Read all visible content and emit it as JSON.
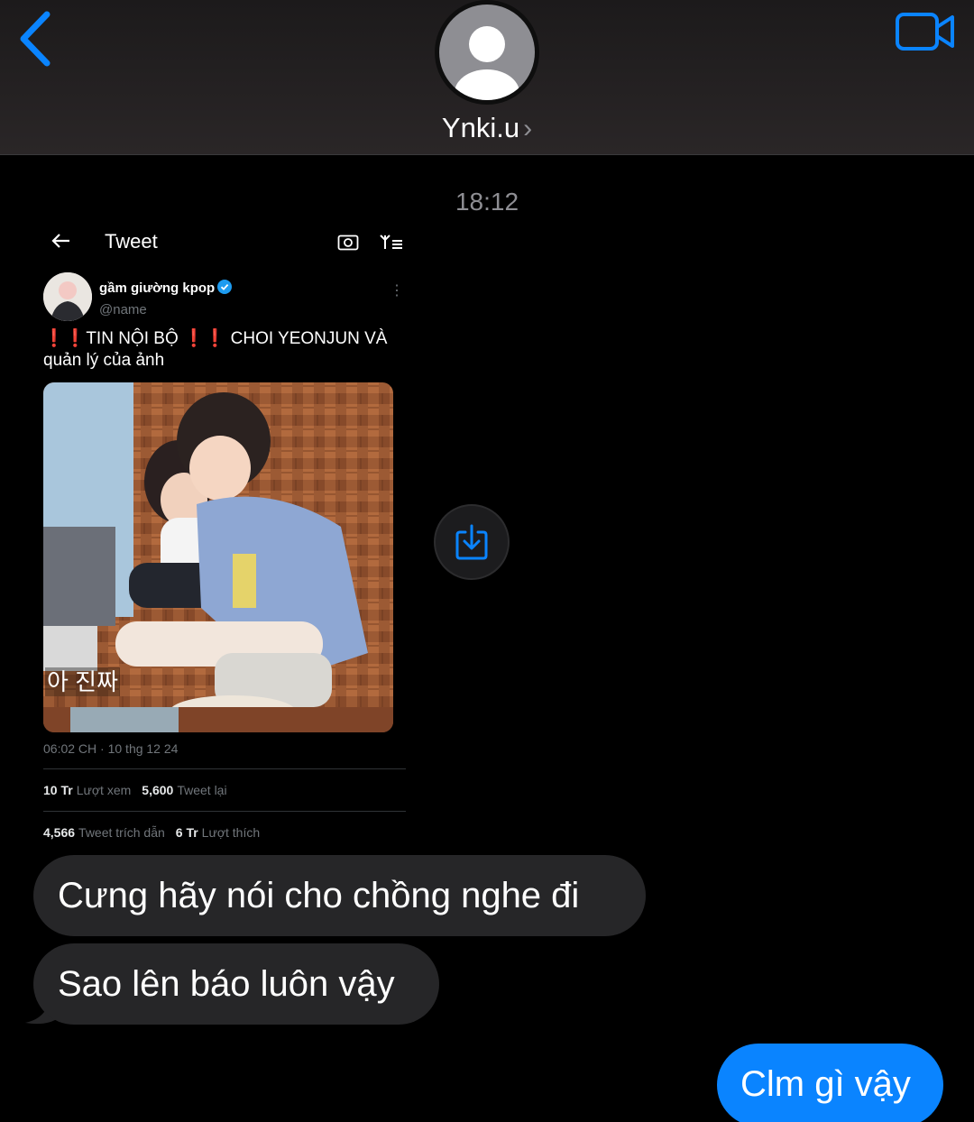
{
  "header": {
    "contact_name": "Ynki.u",
    "chevron": "›",
    "back_icon": "chevron-left-icon",
    "video_icon": "video-camera-icon",
    "accent_color": "#0a84ff"
  },
  "thread": {
    "timestamp": "18:12"
  },
  "shared_screenshot": {
    "screen_title": "Tweet",
    "tweet": {
      "display_name": "gầm giường kpop",
      "handle": "@name",
      "text_prefix": "❗❗",
      "text_a": "TIN NỘI BỘ ",
      "text_mid": "❗❗",
      "text_b": " CHOI YEONJUN VÀ quản lý của ảnh",
      "photo_caption": "아 진짜",
      "posted_at": "06:02 CH · 10 thg 12 24",
      "stats": {
        "views_value": "10 Tr",
        "views_label": "Lượt xem",
        "retweets_value": "5,600",
        "retweets_label": "Tweet lại",
        "quotes_value": "4,566",
        "quotes_label": "Tweet trích dẫn",
        "likes_value": "6 Tr",
        "likes_label": "Lượt thích"
      }
    }
  },
  "messages": [
    {
      "direction": "incoming",
      "text": "Cưng hãy nói cho chồng nghe đi"
    },
    {
      "direction": "incoming",
      "text": "Sao lên báo luôn vậy"
    },
    {
      "direction": "outgoing",
      "text": "Clm gì vậy"
    }
  ]
}
